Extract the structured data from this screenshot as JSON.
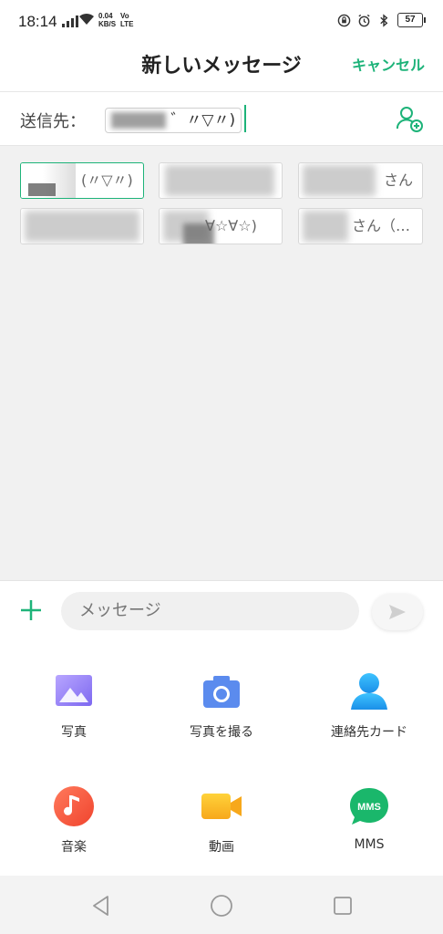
{
  "status": {
    "time": "18:14",
    "speed_top": "0.04",
    "speed_bottom": "KB/S",
    "volte_top": "Vo",
    "volte_bottom": "LTE",
    "battery": "57"
  },
  "header": {
    "title": "新しいメッセージ",
    "cancel": "キャンセル"
  },
  "recipient": {
    "label": "送信先：",
    "entry": "゛〃▽〃)"
  },
  "suggestions": [
    "(〃▽〃)",
    "",
    "さん",
    "",
    "∀☆∀☆)",
    "さん（…"
  ],
  "composer": {
    "placeholder": "メッセージ"
  },
  "attach": [
    {
      "label": "写真",
      "icon": "photo-icon"
    },
    {
      "label": "写真を撮る",
      "icon": "camera-icon"
    },
    {
      "label": "連絡先カード",
      "icon": "contact-card-icon"
    },
    {
      "label": "音楽",
      "icon": "music-icon"
    },
    {
      "label": "動画",
      "icon": "video-icon"
    },
    {
      "label": "MMS",
      "icon": "mms-icon",
      "badge": "MMS"
    }
  ],
  "colors": {
    "accent": "#1db379"
  }
}
